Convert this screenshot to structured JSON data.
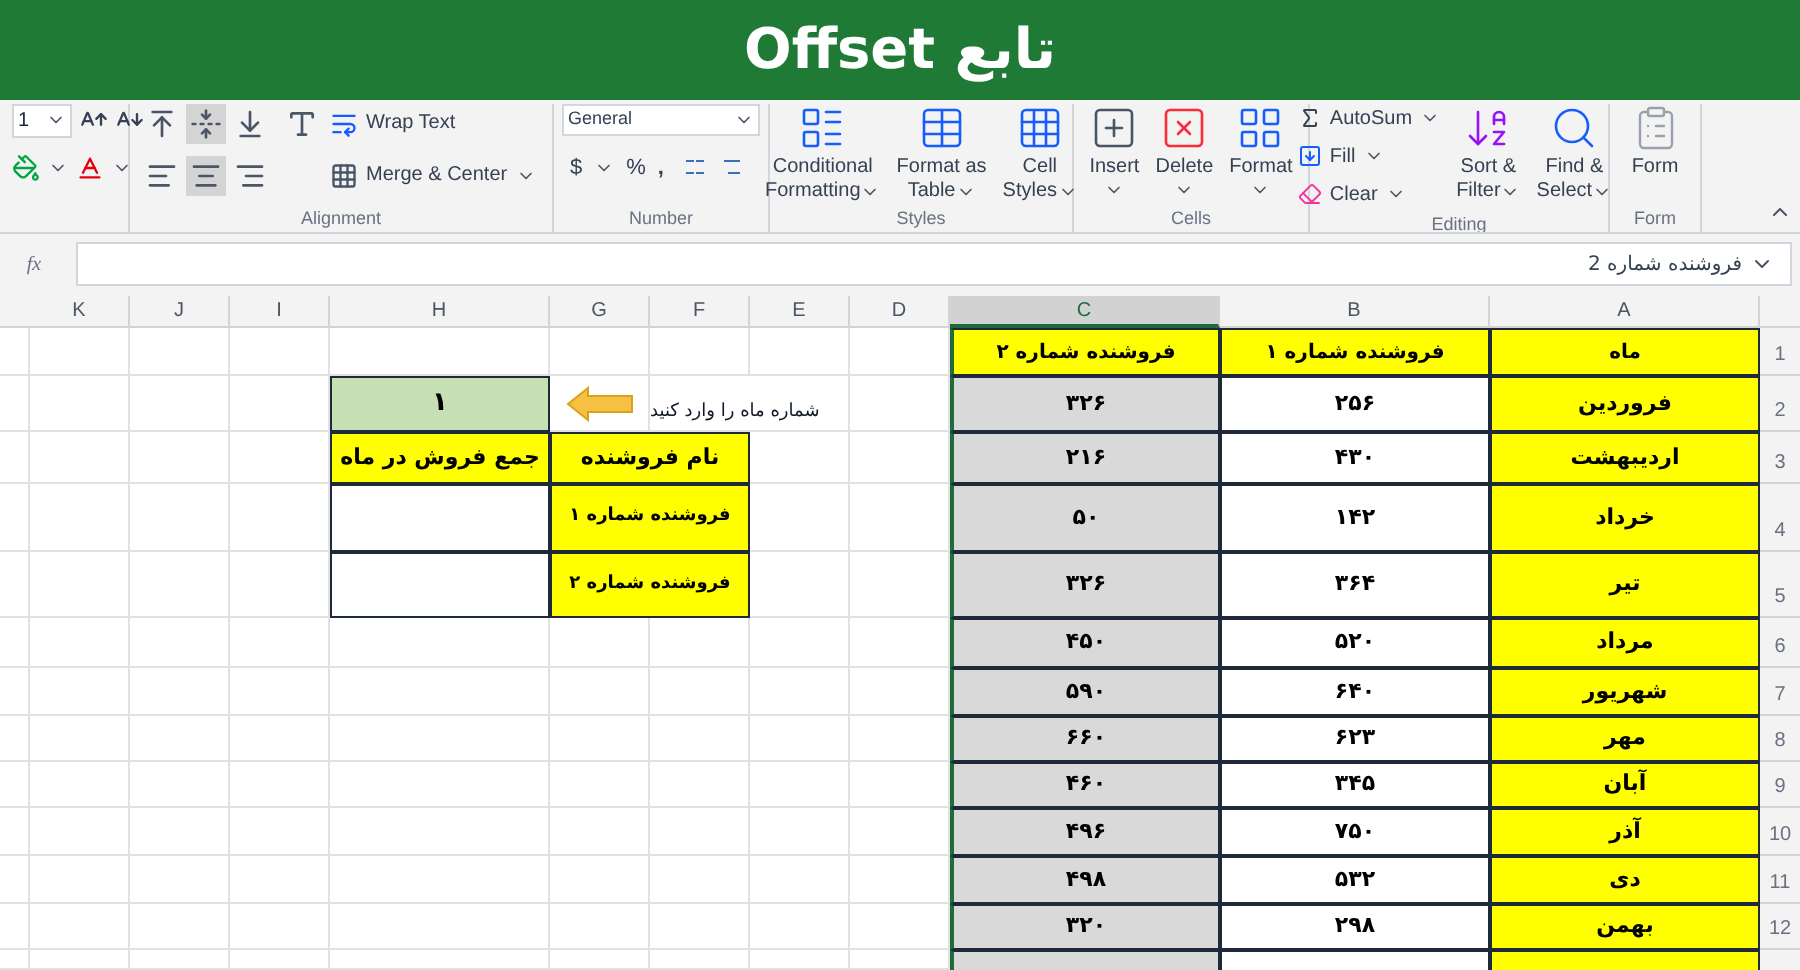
{
  "banner": {
    "title": "تابع Offset"
  },
  "font": {
    "size": "1"
  },
  "alignment": {
    "label": "Alignment",
    "vertical": [
      {
        "kind": "top",
        "selected": false
      },
      {
        "kind": "middle",
        "selected": true
      },
      {
        "kind": "bottom",
        "selected": false
      }
    ],
    "horizontal": [
      {
        "kind": "left",
        "selected": false
      },
      {
        "kind": "center",
        "selected": true
      },
      {
        "kind": "right",
        "selected": false
      }
    ],
    "wrap_text": "Wrap Text",
    "merge": "Merge & Center"
  },
  "number": {
    "label": "Number",
    "format": "General",
    "currency": "$",
    "percent": "%",
    "comma": ","
  },
  "styles": {
    "label": "Styles",
    "buttons": [
      {
        "kind": "cellstyles",
        "lines": [
          "Cell",
          "Styles"
        ]
      },
      {
        "kind": "table",
        "lines": [
          "Format as",
          "Table"
        ]
      },
      {
        "kind": "conditional",
        "lines": [
          "Conditional",
          "Formatting"
        ]
      }
    ]
  },
  "cells": {
    "label": "Cells",
    "buttons": [
      {
        "kind": "format",
        "lines": [
          "Format"
        ]
      },
      {
        "kind": "delete",
        "lines": [
          "Delete"
        ]
      },
      {
        "kind": "insert",
        "lines": [
          "Insert"
        ]
      }
    ]
  },
  "editing": {
    "label": "Editing",
    "small": [
      {
        "kind": "autosum",
        "label": "AutoSum"
      },
      {
        "kind": "fill",
        "label": "Fill"
      },
      {
        "kind": "clear",
        "label": "Clear"
      }
    ],
    "buttons": [
      {
        "kind": "find",
        "lines": [
          "Find &",
          "Select"
        ]
      },
      {
        "kind": "sort",
        "lines": [
          "Sort &",
          "Filter"
        ]
      }
    ]
  },
  "form": {
    "label": "Form",
    "button": "Form"
  },
  "formula_bar": {
    "fx": "fx",
    "value": "فروشنده شماره 2"
  },
  "column_headers": [
    {
      "label": "A",
      "selected": false
    },
    {
      "label": "B",
      "selected": false
    },
    {
      "label": "C",
      "selected": true
    },
    {
      "label": "D",
      "selected": false
    },
    {
      "label": "E",
      "selected": false
    },
    {
      "label": "F",
      "selected": false
    },
    {
      "label": "G",
      "selected": false
    },
    {
      "label": "H",
      "selected": false
    },
    {
      "label": "I",
      "selected": false
    },
    {
      "label": "J",
      "selected": false
    },
    {
      "label": "K",
      "selected": false
    }
  ],
  "row_numbers": [
    "1",
    "2",
    "3",
    "4",
    "5",
    "6",
    "7",
    "8",
    "9",
    "10",
    "11",
    "12"
  ],
  "input": {
    "value": "۱",
    "hint": "شماره ماه را وارد کنید"
  },
  "summary": {
    "columns": [
      "نام فروشنده",
      "جمع فروش در ماه"
    ],
    "sellers": [
      "فروشنده شماره ۱",
      "فروشنده شماره ۲"
    ]
  },
  "sales": {
    "columns": [
      "ماه",
      "فروشنده شماره ۱",
      "فروشنده شماره ۲"
    ],
    "rows": [
      [
        "فروردین",
        "۲۵۶",
        "۳۲۶"
      ],
      [
        "اردیبهشت",
        "۴۳۰",
        "۲۱۶"
      ],
      [
        "خرداد",
        "۱۴۲",
        "۵۰"
      ],
      [
        "تیر",
        "۳۶۴",
        "۳۲۶"
      ],
      [
        "مرداد",
        "۵۲۰",
        "۴۵۰"
      ],
      [
        "شهریور",
        "۶۴۰",
        "۵۹۰"
      ],
      [
        "مهر",
        "۶۲۳",
        "۶۶۰"
      ],
      [
        "آبان",
        "۳۴۵",
        "۴۶۰"
      ],
      [
        "آذر",
        "۷۵۰",
        "۴۹۶"
      ],
      [
        "دی",
        "۵۳۲",
        "۴۹۸"
      ],
      [
        "بهمن",
        "۲۹۸",
        "۳۲۰"
      ]
    ]
  }
}
